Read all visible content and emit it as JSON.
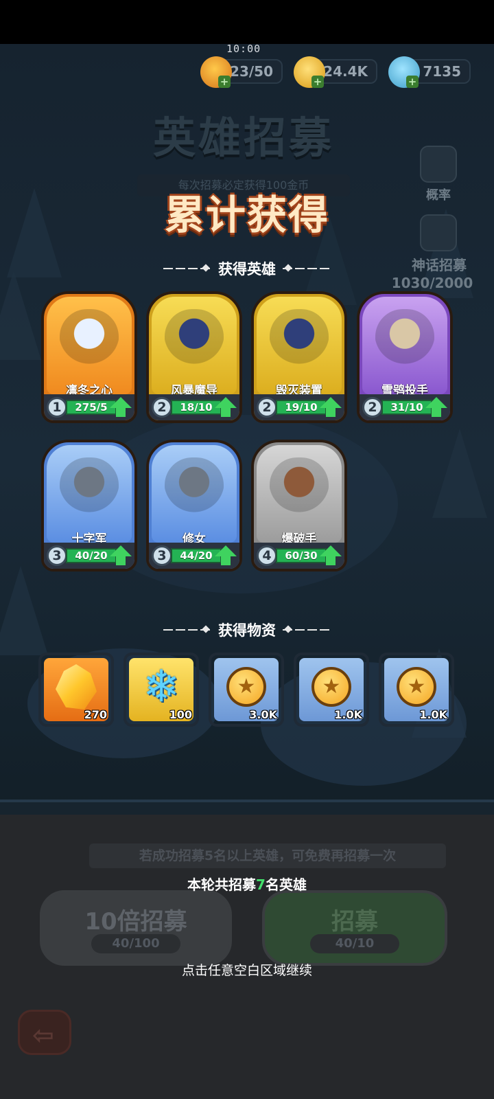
{
  "status": {
    "time": "10:00"
  },
  "resources": [
    {
      "icon": "flame-energy-icon",
      "value": "23/50",
      "color": "#f2a11f"
    },
    {
      "icon": "gold-coin-icon",
      "value": "24.4K",
      "color": "#f0b323"
    },
    {
      "icon": "ice-crystal-icon",
      "value": "7135",
      "color": "#6fc7f0"
    }
  ],
  "background": {
    "title": "英雄招募",
    "subtitle": "每次招募必定获得100金币",
    "odds_label": "概率",
    "myth_label": "神话招募",
    "myth_progress": "1030/2000",
    "notice": "若成功招募5名以上英雄，可免费再招募一次",
    "ten_recruit_label": "10倍招募",
    "ten_recruit_cost": "40/100",
    "recruit_label": "招募",
    "recruit_cost": "40/10"
  },
  "overlay": {
    "title": "累计获得",
    "heroes_header": "获得英雄",
    "materials_header": "获得物资",
    "summary_prefix": "本轮共招募",
    "summary_count": "7",
    "summary_suffix": "名英雄",
    "continue_hint": "点击任意空白区域继续"
  },
  "heroes": [
    {
      "name": "凛冬之心",
      "level": "1",
      "progress": "275/5",
      "rarity": "orange",
      "icon": "ice-queen-icon"
    },
    {
      "name": "风暴魔导",
      "level": "2",
      "progress": "18/10",
      "rarity": "yellow",
      "icon": "storm-wizard-icon"
    },
    {
      "name": "毁灭装置",
      "level": "2",
      "progress": "19/10",
      "rarity": "yellow",
      "icon": "doom-machine-icon"
    },
    {
      "name": "雪鸮投手",
      "level": "2",
      "progress": "31/10",
      "rarity": "purple",
      "icon": "snow-owl-icon"
    },
    {
      "name": "十字军",
      "level": "3",
      "progress": "40/20",
      "rarity": "blue",
      "icon": "crusader-icon"
    },
    {
      "name": "修女",
      "level": "3",
      "progress": "44/20",
      "rarity": "blue",
      "icon": "nun-icon"
    },
    {
      "name": "爆破手",
      "level": "4",
      "progress": "60/30",
      "rarity": "gray",
      "icon": "bomber-icon"
    }
  ],
  "materials": [
    {
      "icon": "gold-crystal-icon",
      "count": "270",
      "tile": "orange"
    },
    {
      "icon": "ice-crystal-icon",
      "count": "100",
      "tile": "yellow"
    },
    {
      "icon": "gold-coin-icon",
      "count": "3.0K",
      "tile": "blue"
    },
    {
      "icon": "gold-coin-icon",
      "count": "1.0K",
      "tile": "blue"
    },
    {
      "icon": "gold-coin-icon",
      "count": "1.0K",
      "tile": "blue"
    }
  ]
}
